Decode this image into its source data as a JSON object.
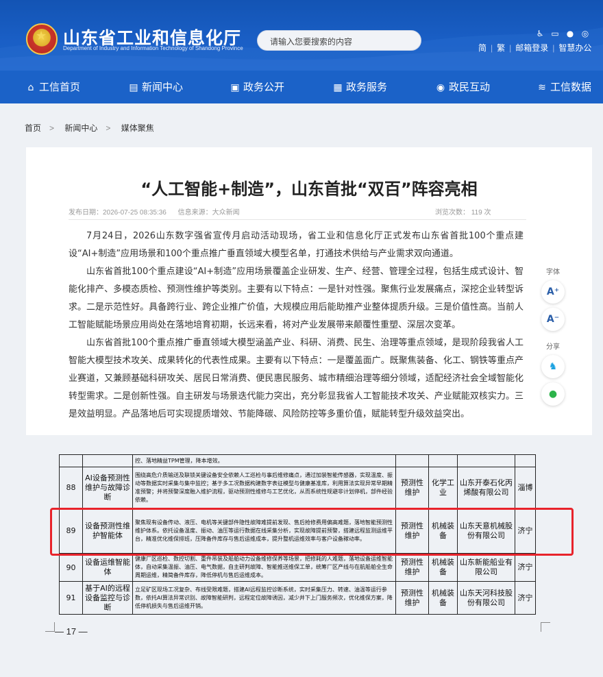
{
  "header": {
    "title": "山东省工业和信息化厅",
    "subtitle": "Department of Industry and Information Technology of Shandong Province",
    "search_placeholder": "请输入您要搜索的内容",
    "icons": [
      "accessibility-icon",
      "monitor-icon",
      "wechat-icon",
      "weibo-icon"
    ],
    "links": [
      "简",
      "繁",
      "邮箱登录",
      "智慧办公"
    ]
  },
  "nav": {
    "items": [
      {
        "label": "工信首页",
        "icon": "home-icon"
      },
      {
        "label": "新闻中心",
        "icon": "news-icon"
      },
      {
        "label": "政务公开",
        "icon": "monitor-icon"
      },
      {
        "label": "政务服务",
        "icon": "service-icon"
      },
      {
        "label": "政民互动",
        "icon": "chat-icon"
      },
      {
        "label": "工信数据",
        "icon": "database-icon"
      }
    ]
  },
  "breadcrumb": [
    "首页",
    "新闻中心",
    "媒体聚焦"
  ],
  "article": {
    "title": "“人工智能+制造”，山东首批“双百”阵容亮相",
    "publish_date": "发布日期：2026-07-25 08:35:36",
    "source": "信息来源：大众新闻",
    "views": "浏览次数：  119     次",
    "paragraphs": [
      "7月24日，2026山东数字强省宣传月启动活动现场，省工业和信息化厅正式发布山东省首批100个重点建设“AI+制造”应用场景和100个重点推广垂直领域大模型名单，打通技术供给与产业需求双向通道。",
      "山东省首批100个重点建设“AI+制造”应用场景覆盖企业研发、生产、经营、管理全过程，包括生成式设计、智能化排产、多模态质检、预测性维护等类别。主要有以下特点：一是针对性强。聚焦行业发展痛点，深挖企业转型诉求。二是示范性好。具备跨行业、跨企业推广价值，大规模应用后能助推产业整体提质升级。三是价值性高。当前人工智能赋能场景应用尚处在落地培育初期，长远来看，将对产业发展带来颠覆性重塑、深层次变革。",
      "山东省首批100个重点推广垂直领域大模型涵盖产业、科研、消费、民生、治理等重点领域，是现阶段我省人工智能大模型技术攻关、成果转化的代表性成果。主要有以下特点：一是覆盖面广。既聚焦装备、化工、钢铁等重点产业赛道，又兼顾基础科研攻关、居民日常消费、便民惠民服务、城市精细治理等细分领域，适配经济社会全域智能化转型需求。二是创新性强。自主研发与场景迭代能力突出，充分彰显我省人工智能技术攻关、产业赋能双核实力。三是效益明显。产品落地后可实现提质增效、节能降碳、风险防控等多重价值，赋能转型升级效益突出。"
    ]
  },
  "side_tools": {
    "font_label": "字体",
    "font_increase": "A⁺",
    "font_decrease": "A⁻",
    "share_label": "分享"
  },
  "doc_table": {
    "top_fragment": "控、落地精益TPM管理，降本增效。",
    "rows": [
      {
        "num": "88",
        "name": "AI设备预测性维护与故障诊断",
        "desc": "围绕高危介质输送及联锁关键设备安全依赖人工巡检与事后维修痛点，通过加装智能传感器，实现温度、振动等数据实时采集与集中监控；基于多工况数据构建数字表征模型与健康基准库，利用算法实现异常早期精准预警；并将预警深度融入维护流程，驱动预测性维修与工艺优化，从而系统性规避非计划停机，部件经验依赖。",
        "type": "预测性维护",
        "industry": "化学工业",
        "company": "山东开泰石化丙烯酸有限公司",
        "city": "淄博"
      },
      {
        "num": "89",
        "name": "设备预测性维护智能体",
        "desc": "聚焦现有设备传动、液压、电机等关键部件隐性故障难提前发现、售后抢修费用偏高难题，落地智能预测性维护体系。依托设备温度、振动、油压等运行数据在线采集分析，实现故障提前预警，搭建远程监测运维平台，精准优化维保排班，压降备件库存与售后运维成本，提升整机运维效率与客户设备稼动率。",
        "type": "预测性维护",
        "industry": "机械装备",
        "company": "山东天意机械股份有限公司",
        "city": "济宁"
      },
      {
        "num": "90",
        "name": "设备运维智能体",
        "desc": "健康厂区巡检、数控切割、重件吊装及船舶动力设备维修保养等场景，把修耗的人难题，落地设备运维智能体，自动采集温振、油压、电气数据，自主研判故障、智能推送维保工单，统筹厂区产线与在航船舶全生命周期运维，精简备件库存，降低停机与售后运维成本。",
        "type": "预测性维护",
        "industry": "机械装备",
        "company": "山东新能船业有限公司",
        "city": "济宁"
      },
      {
        "num": "91",
        "name": "基于AI的远程设备监控与诊断",
        "desc": "立足矿区现场工况复杂、布线受限难题，搭建AI远程监控诊断系统，实时采集压力、转速、油温等运行参数，依托AI算法异常识别、故障智能研判，远程定位故障诱因，减少井下上门服务频次，优化维保方案，降低停机损失与售后运维开销。",
        "type": "预测性维护",
        "industry": "机械装备",
        "company": "山东天河科技股份有限公司",
        "city": "济宁"
      }
    ],
    "page_number": "— 17 —"
  },
  "colors": {
    "header_blue": "#1b62c8",
    "highlight_red": "#e8232b",
    "page_bg": "#eef1f5"
  }
}
